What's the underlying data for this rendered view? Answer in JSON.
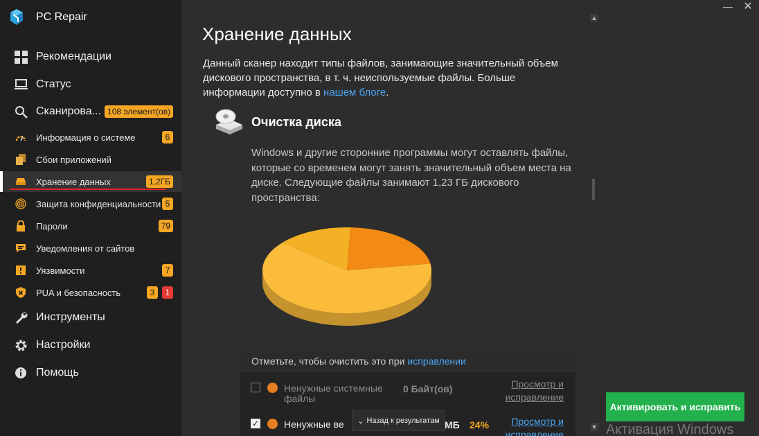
{
  "app": {
    "title": "PC Repair"
  },
  "sidebar": {
    "main_items": [
      {
        "label": "Рекомендации",
        "icon": "grid-icon"
      },
      {
        "label": "Статус",
        "icon": "laptop-icon"
      },
      {
        "label": "Сканирова...",
        "icon": "magnifier-icon",
        "badge": "108 элемент(ов)"
      },
      {
        "label": "Инструменты",
        "icon": "wrench-icon"
      },
      {
        "label": "Настройки",
        "icon": "gear-icon"
      },
      {
        "label": "Помощь",
        "icon": "info-icon"
      }
    ],
    "sub_items": [
      {
        "label": "Информация о системе",
        "icon": "gauge-icon",
        "badge": "6"
      },
      {
        "label": "Сбои приложений",
        "icon": "files-icon"
      },
      {
        "label": "Хранение данных",
        "icon": "drive-icon",
        "badge": "1,2ГБ",
        "active": true
      },
      {
        "label": "Защита конфиденциальности",
        "icon": "fingerprint-icon",
        "badge": "5"
      },
      {
        "label": "Пароли",
        "icon": "padlock-icon",
        "badge": "79"
      },
      {
        "label": "Уведомления от сайтов",
        "icon": "chat-icon"
      },
      {
        "label": "Уязвимости",
        "icon": "bug-icon",
        "badge": "7"
      },
      {
        "label": "PUA и безопасность",
        "icon": "shield-icon",
        "badge": "3",
        "badge_red": "1"
      }
    ]
  },
  "main": {
    "title": "Хранение данных",
    "intro": "Данный сканер находит типы файлов, занимающие значительный объем дискового пространства, в т. ч. неиспользуемые файлы. Больше информации доступно в ",
    "intro_link": "нашем блоге",
    "intro_end": ".",
    "section_title": "Очистка диска",
    "section_desc": "Windows и другие сторонние программы могут оставлять файлы, которые со временем могут занять значительный объем места на диске. Следующие файлы занимают 1,23 ГБ дискового пространства:",
    "list_header": "Отметьте, чтобы очистить это при ",
    "list_header_link": "исправлении",
    "rows": [
      {
        "name": "Ненужные системные файлы",
        "size": "0 Байт(ов)",
        "percent": "",
        "action": "Просмотр и исправление",
        "checked": false,
        "color": "#e67e22"
      },
      {
        "name": "Ненужные ве",
        "size": "МБ",
        "percent": "24%",
        "action": "Просмотр и исправление",
        "checked": true,
        "color": "#e67e22"
      }
    ],
    "back_label": "Назад к результатам"
  },
  "chart_data": {
    "type": "pie",
    "slices": [
      {
        "value": 0.7,
        "color": "#fbbc3b"
      },
      {
        "value": 0.16,
        "color": "#f5b125"
      },
      {
        "value": 0.24,
        "color": "#f28a13"
      }
    ]
  },
  "actions": {
    "activate_label": "Активировать и исправить"
  },
  "watermark": "Активация Windows",
  "window": {
    "minimize": "—",
    "close": "✕"
  },
  "colors": {
    "accent": "#f5a623",
    "active_underline": "#e0271e",
    "activate": "#22b14c",
    "link": "#4aa3f0"
  }
}
